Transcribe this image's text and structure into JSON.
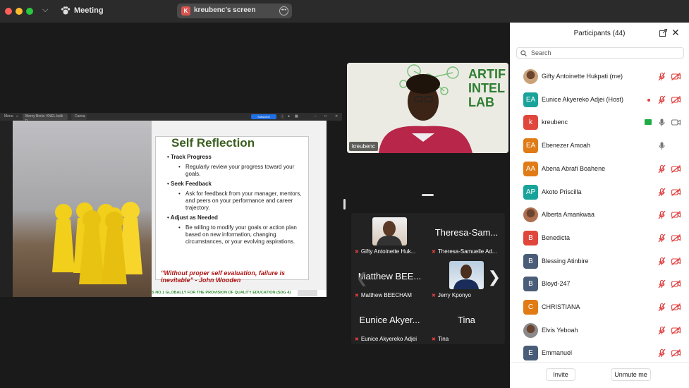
{
  "window": {
    "meeting_label": "Meeting",
    "share_badge": "K",
    "share_label": "kreubenc's screen"
  },
  "browser": {
    "menu": "Menu",
    "tab_title": "Mercy Berla- KNEL bulk p...",
    "tab2": "Canva",
    "subscribe": "Subscribe"
  },
  "slide": {
    "title": "Self Reflection",
    "sections": [
      {
        "heading": "Track Progress",
        "item": "Regularly review your progress toward your goals."
      },
      {
        "heading": "Seek Feedback",
        "item": "Ask for feedback from your manager, mentors, and peers on your performance and career trajectory."
      },
      {
        "heading": "Adjust as Needed",
        "item": "Be willing to modify your goals or action plan based on new information, changing circumstances, or your evolving aspirations."
      }
    ],
    "quote": "“Without proper self evaluation, failure is inevitable” - John Wooden",
    "footer": "S NO.1 GLOBALLY FOR THE PROVISION OF QUALITY EDUCATION (SDG 4)"
  },
  "speaker": {
    "name": "kreubenc",
    "sign": "ARTIF\nINTEL\nLAB"
  },
  "gallery": {
    "tiles": [
      {
        "big": "",
        "name": "Gifty Antoinette Huk..."
      },
      {
        "big": "Theresa-Sam...",
        "name": "Theresa-Samuelle Ad..."
      },
      {
        "big": "Matthew BEE...",
        "name": "Matthew BEECHAM"
      },
      {
        "big": "",
        "name": "Jerry Kponyo"
      },
      {
        "big": "Eunice Akyer...",
        "name": "Eunice Akyereko Adjei"
      },
      {
        "big": "Tina",
        "name": "Tina"
      }
    ]
  },
  "panel": {
    "title": "Participants (44)",
    "search_placeholder": "Search",
    "invite": "Invite",
    "unmute": "Unmute me",
    "participants": [
      {
        "name": "Gifty Antoinette Hukpati (me)",
        "initials": "",
        "color": "#c9a27a",
        "mic": "muted",
        "cam": "off"
      },
      {
        "name": "Eunice Akyereko Adjei (Host)",
        "initials": "EA",
        "color": "#1aa39a",
        "mic": "muted",
        "cam": "off",
        "rec": true
      },
      {
        "name": "kreubenc",
        "initials": "k",
        "color": "#e0473c",
        "mic": "on",
        "cam": "on",
        "sharing": true
      },
      {
        "name": "Ebenezer Amoah",
        "initials": "EA",
        "color": "#e07b16",
        "mic": "on",
        "cam": "none"
      },
      {
        "name": "Abena Abrafi Boahene",
        "initials": "AA",
        "color": "#e07b16",
        "mic": "muted",
        "cam": "off"
      },
      {
        "name": "Akoto Priscilla",
        "initials": "AP",
        "color": "#1aa39a",
        "mic": "muted",
        "cam": "off"
      },
      {
        "name": "Alberta Amankwaa",
        "initials": "",
        "color": "#b07050",
        "mic": "muted",
        "cam": "off"
      },
      {
        "name": "Benedicta",
        "initials": "B",
        "color": "#e0473c",
        "mic": "muted",
        "cam": "off"
      },
      {
        "name": "Blessing Atinbire",
        "initials": "B",
        "color": "#4a5d78",
        "mic": "muted",
        "cam": "off"
      },
      {
        "name": "Bloyd-247",
        "initials": "B",
        "color": "#4a5d78",
        "mic": "muted",
        "cam": "off"
      },
      {
        "name": "CHRISTIANA",
        "initials": "C",
        "color": "#e07b16",
        "mic": "muted",
        "cam": "off"
      },
      {
        "name": "Elvis Yeboah",
        "initials": "",
        "color": "#8a8a8a",
        "mic": "muted",
        "cam": "off"
      },
      {
        "name": "Emmanuel",
        "initials": "E",
        "color": "#4a5d78",
        "mic": "muted",
        "cam": "off"
      }
    ]
  }
}
